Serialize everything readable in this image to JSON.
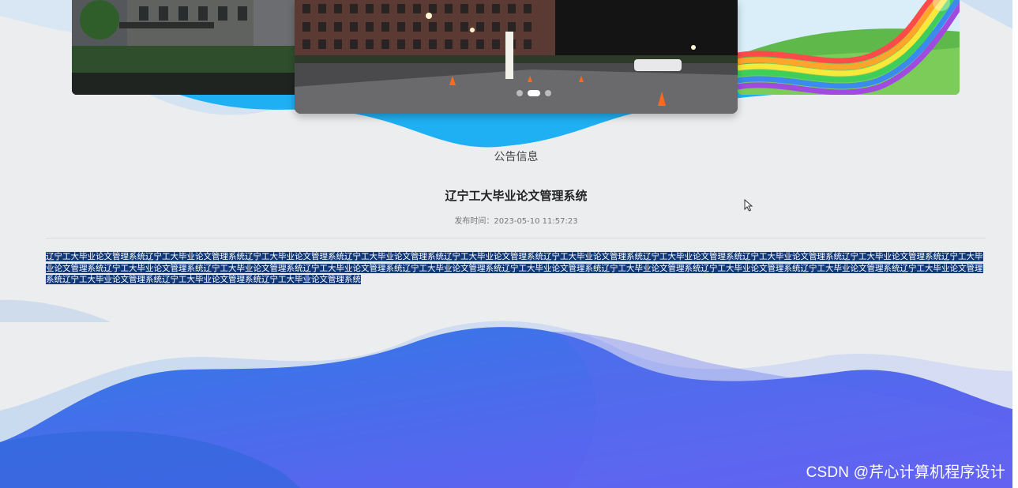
{
  "carousel": {
    "slides": [
      "campus-building",
      "campus-night-road",
      "rainbow-hill"
    ],
    "active_index": 1,
    "dot_count": 3
  },
  "notice": {
    "section_heading": "公告信息",
    "title": "辽宁工大毕业论文管理系统",
    "published": "发布时间：2023-05-10 11:57:23",
    "content": "辽宁工大毕业论文管理系统辽宁工大毕业论文管理系统辽宁工大毕业论文管理系统辽宁工大毕业论文管理系统辽宁工大毕业论文管理系统辽宁工大毕业论文管理系统辽宁工大毕业论文管理系统辽宁工大毕业论文管理系统辽宁工大毕业论文管理系统辽宁工大毕业论文管理系统辽宁工大毕业论文管理系统辽宁工大毕业论文管理系统辽宁工大毕业论文管理系统辽宁工大毕业论文管理系统辽宁工大毕业论文管理系统辽宁工大毕业论文管理系统辽宁工大毕业论文管理系统辽宁工大毕业论文管理系统辽宁工大毕业论文管理系统辽宁工大毕业论文管理系统辽宁工大毕业论文管理系统辽宁工大毕业论文管理系统"
  },
  "watermark": "CSDN @芹心计算机程序设计",
  "colors": {
    "page_bg": "#ecedef",
    "wave_blue": "#1fa8f2",
    "wave_bottom_start": "#2f6fe0",
    "wave_bottom_end": "#5a5ef0",
    "selection": "#123a7a"
  },
  "icons": [
    "pointer-cursor-icon",
    "chevron-right-icon"
  ]
}
